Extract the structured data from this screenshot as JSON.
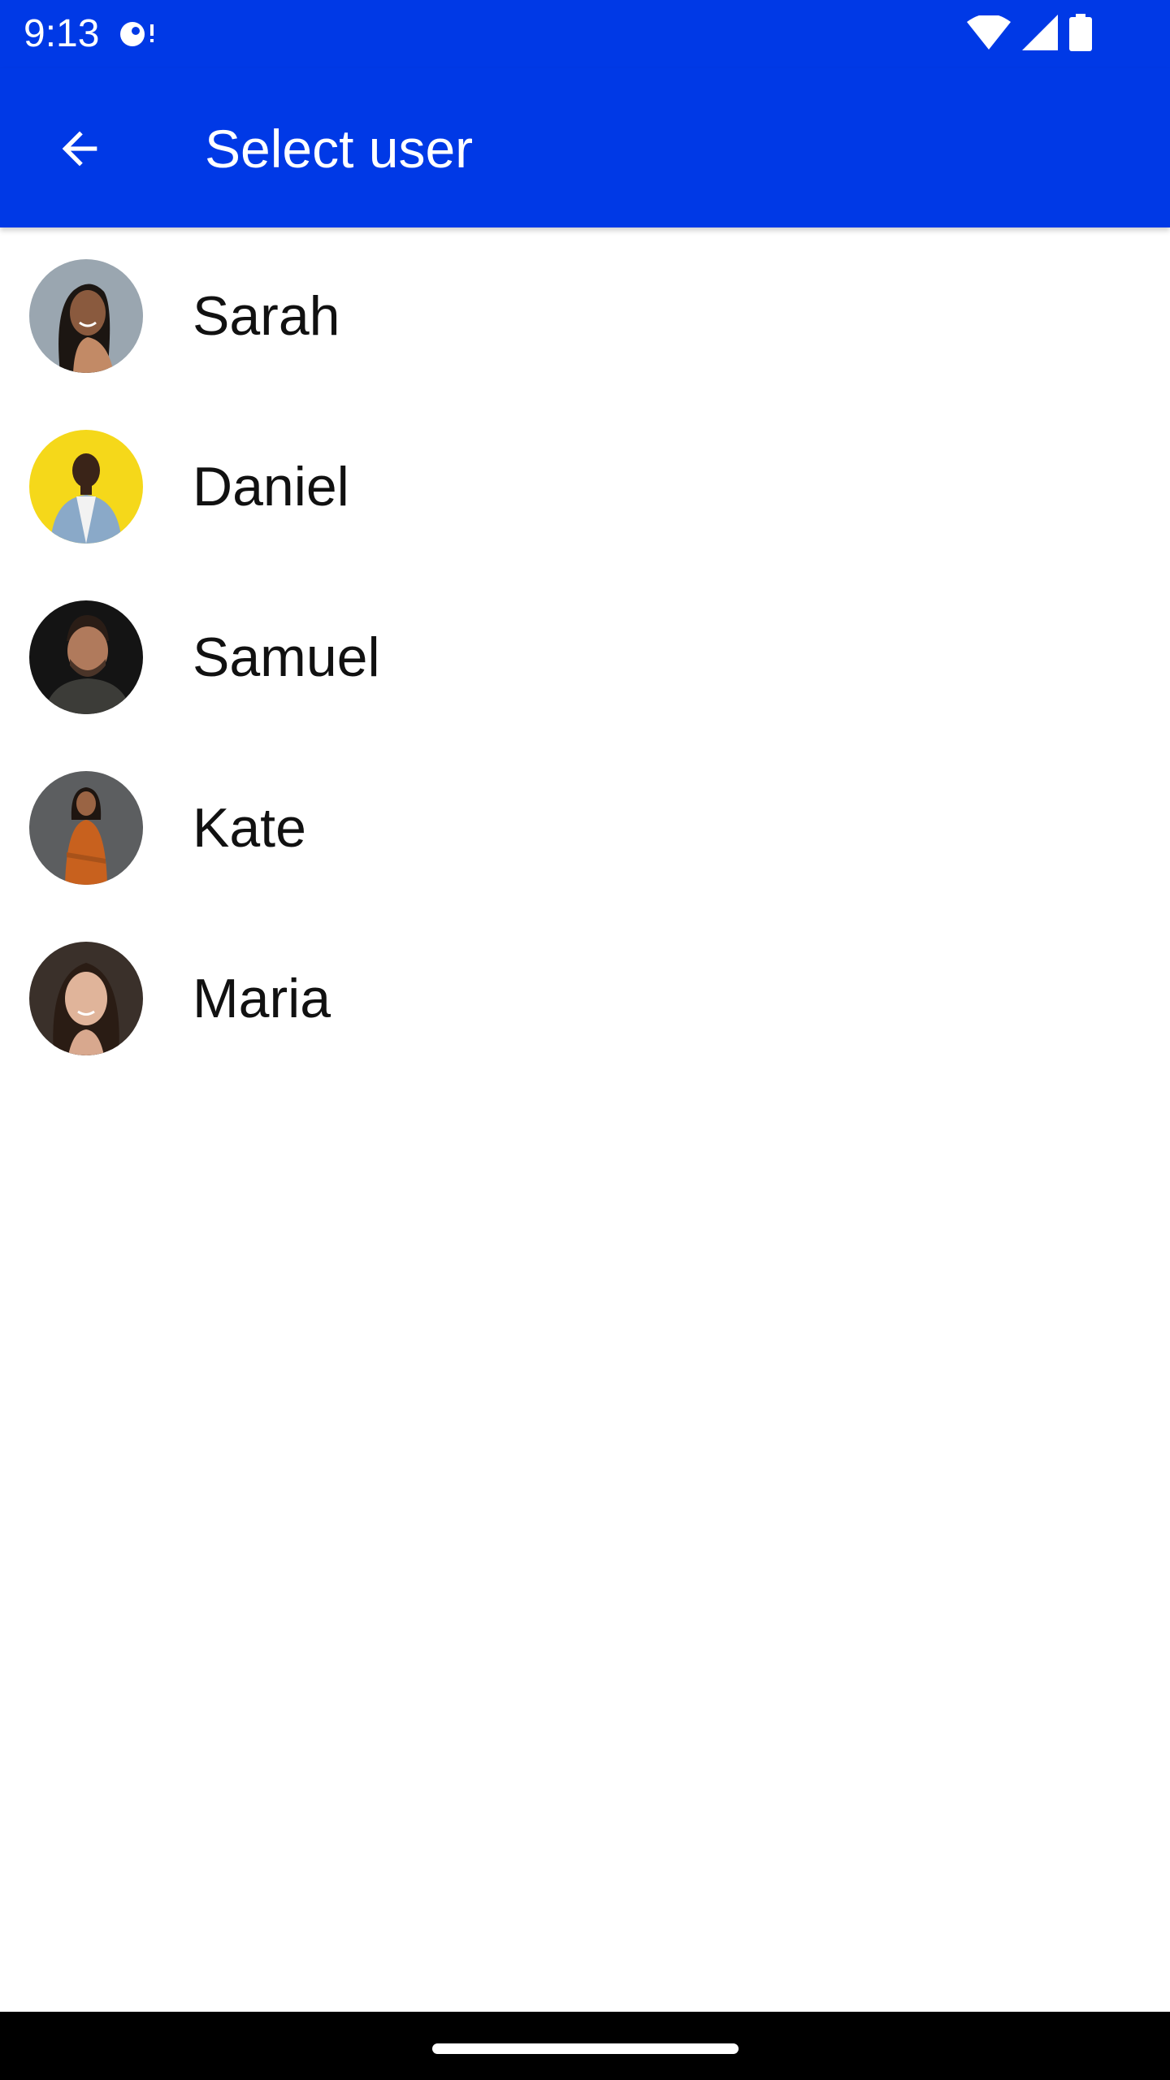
{
  "status_bar": {
    "time": "9:13",
    "icons": [
      "notification-icon",
      "wifi-icon",
      "cell-signal-icon",
      "battery-icon"
    ]
  },
  "app_bar": {
    "title": "Select user",
    "back_icon": "arrow-back-icon",
    "background_color": "#0039E6"
  },
  "users": [
    {
      "name": "Sarah",
      "avatar_bg": "#8a9aa8"
    },
    {
      "name": "Daniel",
      "avatar_bg": "#f5d81a"
    },
    {
      "name": "Samuel",
      "avatar_bg": "#1a1a1a"
    },
    {
      "name": "Kate",
      "avatar_bg": "#5c5e60"
    },
    {
      "name": "Maria",
      "avatar_bg": "#3a302a"
    }
  ],
  "navigation_bar": {
    "home_handle": "home-handle"
  }
}
